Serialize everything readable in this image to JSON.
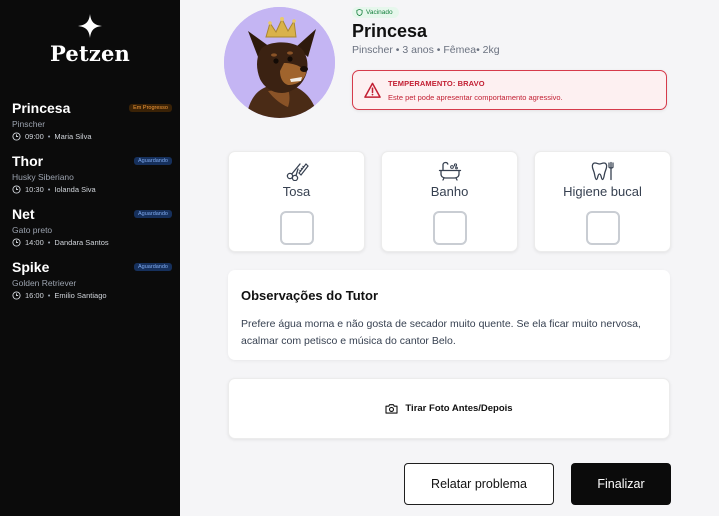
{
  "app": {
    "logo": "Petzen"
  },
  "sidebar": {
    "pets": [
      {
        "name": "Princesa",
        "status": "Em Progresso",
        "status_type": "progress",
        "breed": "Pinscher",
        "time": "09:00",
        "owner": "Maria Silva"
      },
      {
        "name": "Thor",
        "status": "Aguardando",
        "status_type": "waiting",
        "breed": "Husky Siberiano",
        "time": "10:30",
        "owner": "Iolanda Siva"
      },
      {
        "name": "Net",
        "status": "Aguardando",
        "status_type": "waiting",
        "breed": "Gato preto",
        "time": "14:00",
        "owner": "Dandara Santos"
      },
      {
        "name": "Spike",
        "status": "Aguardando",
        "status_type": "waiting",
        "breed": "Golden Retriever",
        "time": "16:00",
        "owner": "Emilio Santiago"
      }
    ]
  },
  "profile": {
    "badge": "Vacinado",
    "name": "Princesa",
    "info": "Pinscher • 3 anos • Fêmea• 2kg",
    "alert": {
      "title": "TEMPERAMENTO: BRAVO",
      "text": "Este pet pode apresentar comportamento agressivo."
    }
  },
  "services": [
    {
      "label": "Tosa",
      "icon": "scissors-comb-icon",
      "checked": false
    },
    {
      "label": "Banho",
      "icon": "bathtub-icon",
      "checked": false
    },
    {
      "label": "Higiene bucal",
      "icon": "tooth-icon",
      "checked": false
    }
  ],
  "observations": {
    "title": "Observações do Tutor",
    "text": "Prefere água morna e não gosta de secador muito quente. Se ela ficar muito nervosa, acalmar com petisco e música do cantor Belo."
  },
  "photo": {
    "label": "Tirar Foto Antes/Depois",
    "icon": "camera-icon"
  },
  "actions": {
    "report": "Relatar problema",
    "finish": "Finalizar"
  },
  "colors": {
    "sidebar_bg": "#0b0b0b",
    "alert_red": "#c21f33",
    "progress_badge": "#f39a3a",
    "waiting_badge": "#7fa9ee",
    "vaccinated_green": "#15803d",
    "avatar_bg": "#c4b5f3"
  }
}
